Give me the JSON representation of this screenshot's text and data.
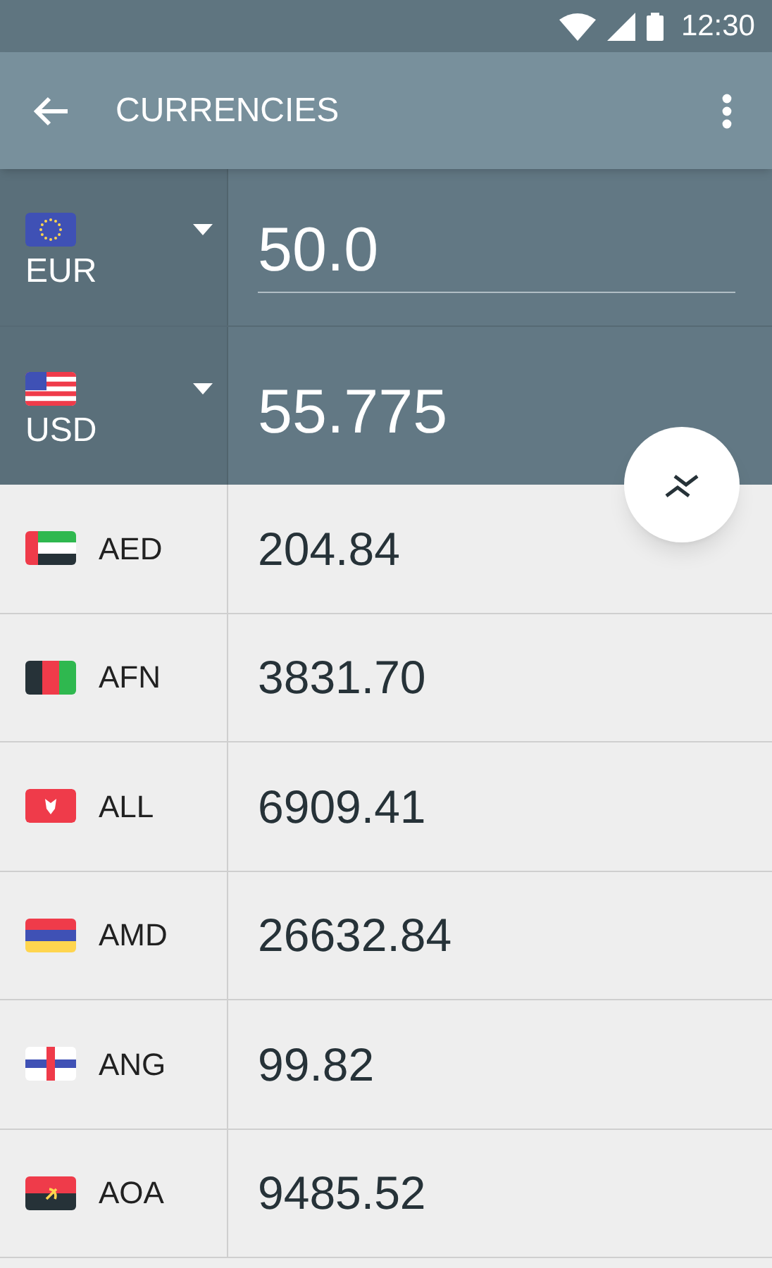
{
  "status_bar": {
    "time": "12:30"
  },
  "toolbar": {
    "title": "CURRENCIES"
  },
  "base": [
    {
      "kind": "stars",
      "code": "EUR",
      "value": "50.0",
      "editable": true
    },
    {
      "kind": "stars-stripes",
      "code": "USD",
      "value": "55.775",
      "editable": false
    }
  ],
  "rates": [
    {
      "kind": "hoist-stripes",
      "code": "AED",
      "value": "204.84"
    },
    {
      "kind": "vertical",
      "code": "AFN",
      "value": "3831.70"
    },
    {
      "kind": "emblem",
      "code": "ALL",
      "value": "6909.41"
    },
    {
      "kind": "horizontal",
      "code": "AMD",
      "value": "26632.84"
    },
    {
      "kind": "cross",
      "code": "ANG",
      "value": "99.82"
    },
    {
      "kind": "bicolor-emblem",
      "code": "AOA",
      "value": "9485.52"
    }
  ]
}
